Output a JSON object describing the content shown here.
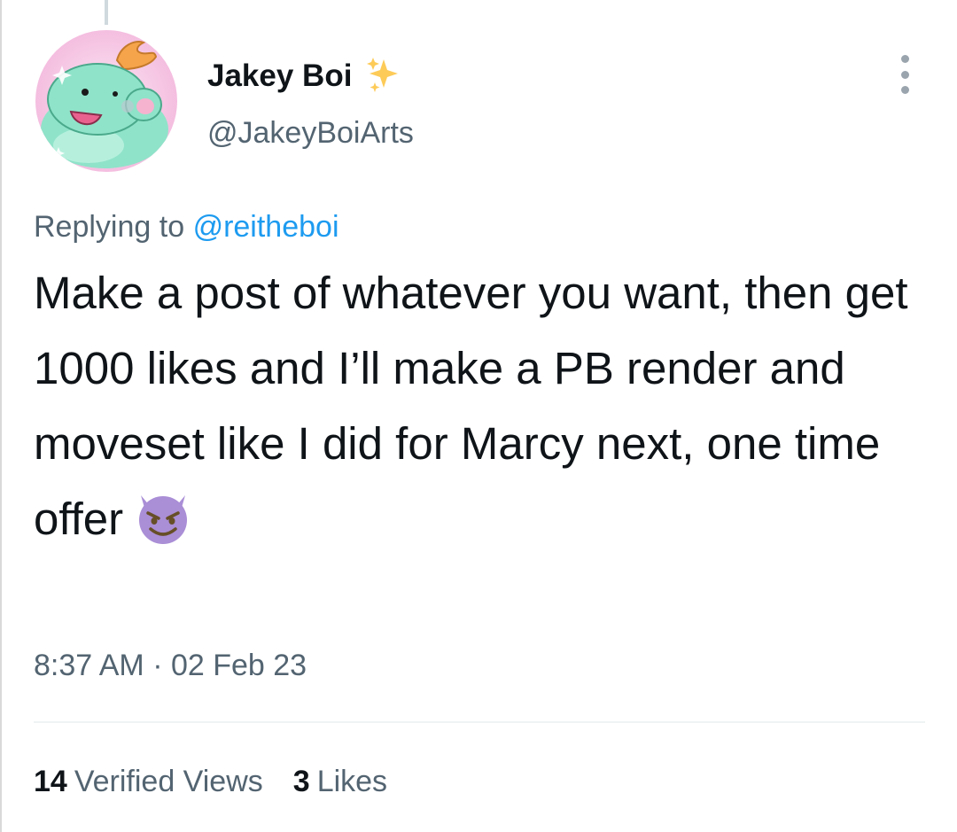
{
  "tweet": {
    "author": {
      "display_name": "Jakey Boi",
      "handle": "@JakeyBoiArts",
      "badge_icon": "sparkles-icon"
    },
    "reply": {
      "prefix": "Replying to",
      "mention": "@reitheboi"
    },
    "text": "Make a post of whatever you want, then get 1000 likes and I’ll make a PB render and moveset like I did for Marcy next, one time offer",
    "emoji": "smiling-imp-icon",
    "timestamp": "8:37 AM · 02 Feb 23",
    "stats": {
      "views_count": "14",
      "views_label": "Verified Views",
      "likes_count": "3",
      "likes_label": "Likes"
    }
  },
  "colors": {
    "primary_text": "#0f1419",
    "secondary_text": "#536471",
    "link": "#1d9bf0",
    "divider": "#eff3f4",
    "emoji_purple": "#aa8ed6"
  }
}
